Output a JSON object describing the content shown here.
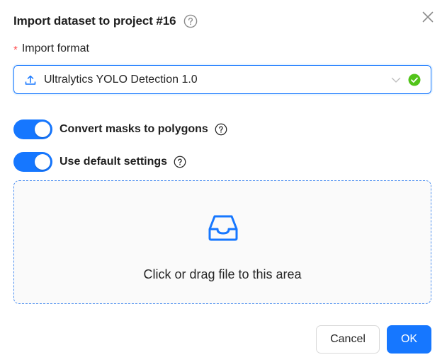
{
  "dialog": {
    "title": "Import dataset to project #16",
    "help_icon": "question-circle-icon",
    "close_icon": "close-icon"
  },
  "format_field": {
    "required_mark": "*",
    "label": "Import format",
    "value": "Ultralytics YOLO Detection 1.0",
    "leading_icon": "upload-icon",
    "dropdown_icon": "chevron-down-icon",
    "status_icon": "check-circle-icon",
    "status_color": "#52c41a"
  },
  "options": [
    {
      "label": "Convert masks to polygons",
      "enabled": true,
      "help_icon": "question-circle-icon"
    },
    {
      "label": "Use default settings",
      "enabled": true,
      "help_icon": "question-circle-icon"
    }
  ],
  "dropzone": {
    "icon": "inbox-icon",
    "hint": "Click or drag file to this area"
  },
  "footer": {
    "cancel_label": "Cancel",
    "ok_label": "OK"
  },
  "colors": {
    "primary": "#1677ff",
    "required": "#ff4d4f",
    "border": "#d9d9d9"
  }
}
